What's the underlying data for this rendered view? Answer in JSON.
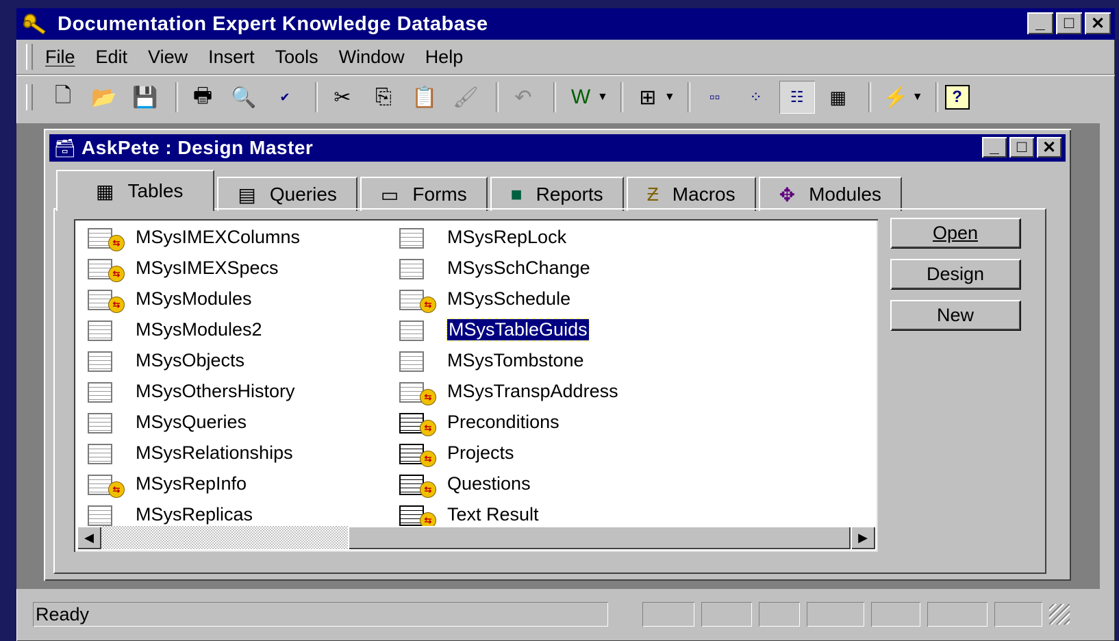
{
  "app": {
    "title": "Documentation Expert Knowledge Database",
    "title_icon": "keys-icon"
  },
  "menu": [
    "File",
    "Edit",
    "View",
    "Insert",
    "Tools",
    "Window",
    "Help"
  ],
  "toolbar": [
    "new-icon",
    "open-icon",
    "save-icon",
    "print-icon",
    "print-preview-icon",
    "spelling-icon",
    "cut-icon",
    "copy-icon",
    "paste-icon",
    "format-painter-icon",
    "undo-icon",
    "office-links-icon",
    "analyze-icon",
    "large-icons-icon",
    "small-icons-icon",
    "list-icon",
    "details-icon",
    "new-object-icon",
    "help-icon"
  ],
  "child": {
    "title": "AskPete : Design Master"
  },
  "tabs": [
    {
      "label": "Tables",
      "icon": "table-icon"
    },
    {
      "label": "Queries",
      "icon": "query-icon"
    },
    {
      "label": "Forms",
      "icon": "form-icon"
    },
    {
      "label": "Reports",
      "icon": "report-icon"
    },
    {
      "label": "Macros",
      "icon": "macro-icon"
    },
    {
      "label": "Modules",
      "icon": "module-icon"
    }
  ],
  "tables_col1": [
    {
      "name": "MSysIMEXColumns",
      "linked": true
    },
    {
      "name": "MSysIMEXSpecs",
      "linked": true
    },
    {
      "name": "MSysModules",
      "linked": true
    },
    {
      "name": "MSysModules2",
      "linked": false
    },
    {
      "name": "MSysObjects",
      "linked": false
    },
    {
      "name": "MSysOthersHistory",
      "linked": false
    },
    {
      "name": "MSysQueries",
      "linked": false
    },
    {
      "name": "MSysRelationships",
      "linked": false
    },
    {
      "name": "MSysRepInfo",
      "linked": true
    },
    {
      "name": "MSysReplicas",
      "linked": false
    }
  ],
  "tables_col2": [
    {
      "name": "MSysRepLock",
      "linked": false
    },
    {
      "name": "MSysSchChange",
      "linked": false
    },
    {
      "name": "MSysSchedule",
      "linked": true
    },
    {
      "name": "MSysTableGuids",
      "linked": false,
      "selected": true
    },
    {
      "name": "MSysTombstone",
      "linked": false
    },
    {
      "name": "MSysTranspAddress",
      "linked": true
    },
    {
      "name": "Preconditions",
      "linked": true,
      "user": true
    },
    {
      "name": "Projects",
      "linked": true,
      "user": true
    },
    {
      "name": "Questions",
      "linked": true,
      "user": true
    },
    {
      "name": "Text Result",
      "linked": true,
      "user": true
    }
  ],
  "buttons": {
    "open": "Open",
    "design": "Design",
    "new": "New"
  },
  "status": {
    "text": "Ready"
  }
}
